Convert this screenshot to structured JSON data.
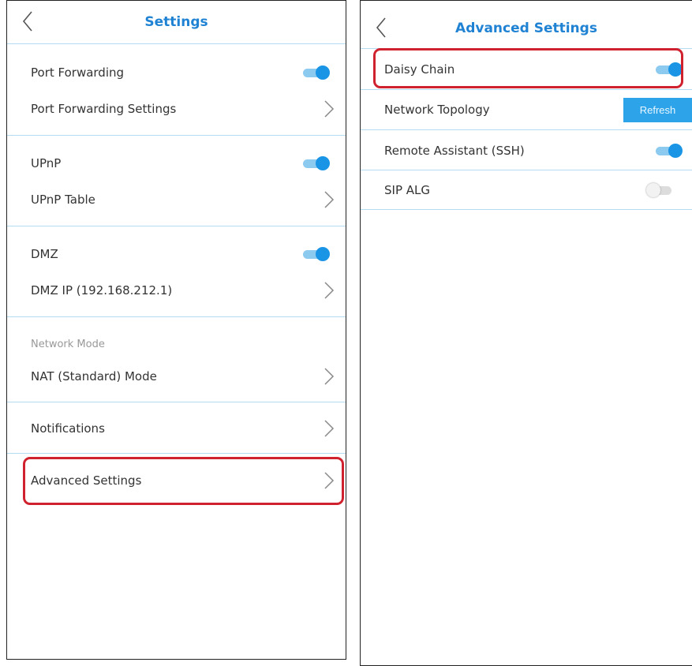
{
  "settings": {
    "title": "Settings",
    "port_forwarding": "Port Forwarding",
    "port_forwarding_settings": "Port Forwarding Settings",
    "upnp": "UPnP",
    "upnp_table": "UPnP Table",
    "dmz": "DMZ",
    "dmz_ip": "DMZ IP (192.168.212.1)",
    "network_mode_label": "Network Mode",
    "nat_mode": "NAT (Standard) Mode",
    "notifications": "Notifications",
    "advanced_settings": "Advanced Settings",
    "toggles": {
      "port_forwarding": true,
      "upnp": true,
      "dmz": true
    }
  },
  "advanced": {
    "title": "Advanced Settings",
    "daisy_chain": "Daisy Chain",
    "network_topology": "Network Topology",
    "refresh_label": "Refresh",
    "remote_assistant": "Remote Assistant (SSH)",
    "sip_alg": "SIP ALG",
    "toggles": {
      "daisy_chain": true,
      "remote_assistant": true,
      "sip_alg": false
    }
  },
  "colors": {
    "accent": "#1f82d3",
    "toggle_on": "#1a95e6",
    "divider": "#b3dbf1",
    "highlight": "#d0212e",
    "refresh_button": "#2da4ea"
  },
  "icons": {
    "back": "chevron-left-icon",
    "row": "chevron-right-icon"
  }
}
